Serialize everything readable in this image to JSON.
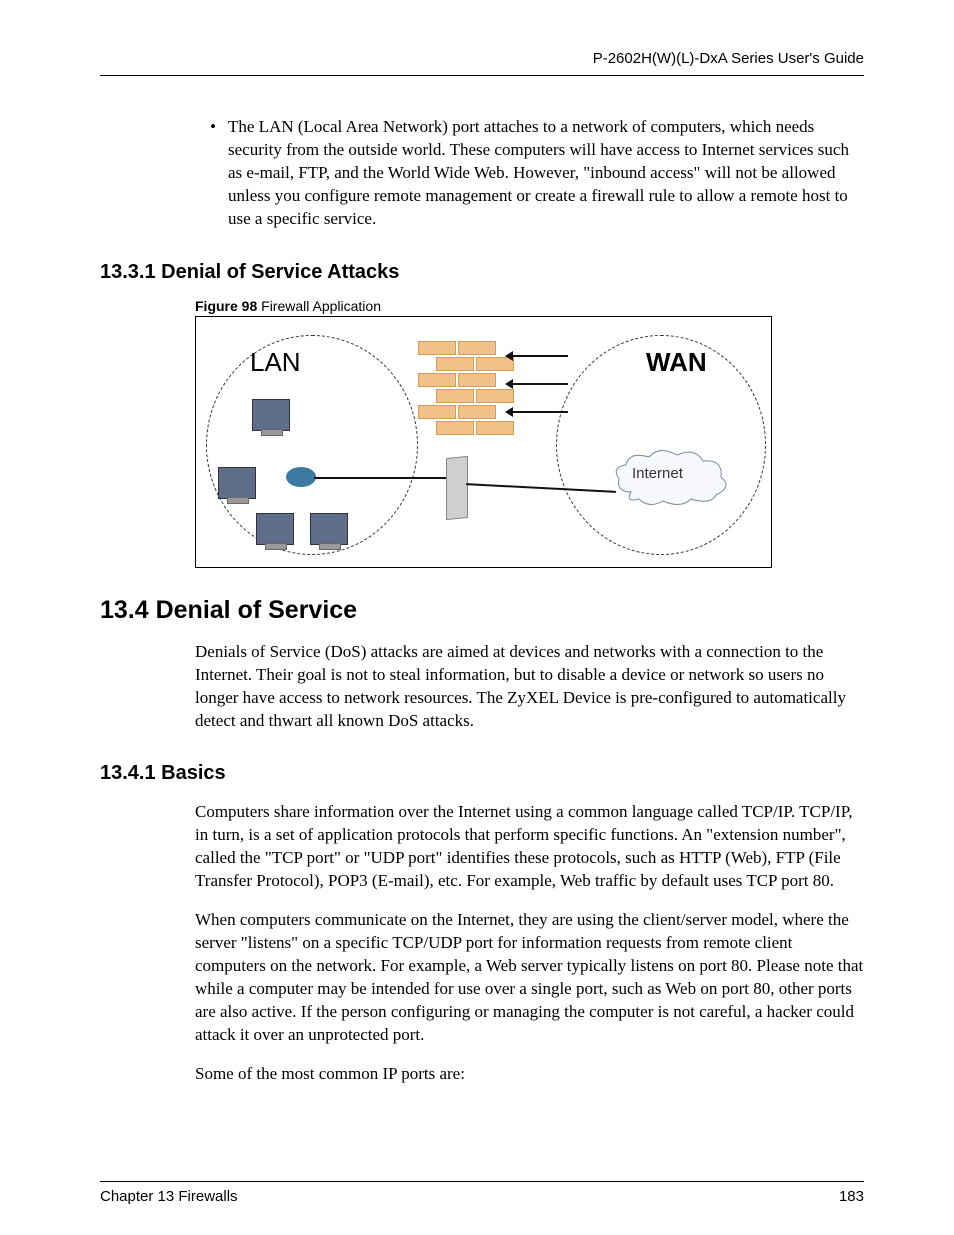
{
  "header": {
    "guide_title": "P-2602H(W)(L)-DxA Series User's Guide"
  },
  "bullet": {
    "text": "The LAN (Local Area Network) port attaches to a network of computers, which needs security from the outside world. These computers will have access to Internet services such as e-mail, FTP, and the World Wide Web.  However, \"inbound access\" will not be allowed unless you configure remote management or create a firewall rule to allow a remote host to use a specific service."
  },
  "sections": {
    "s1331_title": "13.3.1  Denial of Service Attacks",
    "fig98_label_bold": "Figure 98",
    "fig98_label_rest": "   Firewall Application",
    "s134_title": "13.4  Denial of Service",
    "s134_para": "Denials of Service (DoS) attacks are aimed at devices and networks with a connection to the Internet. Their goal is not to steal information, but to disable a device or network so users no longer have access to network resources. The ZyXEL Device is pre-configured to automatically detect and thwart all known DoS attacks.",
    "s1341_title": "13.4.1  Basics",
    "s1341_p1": "Computers share information over the Internet using a common language called TCP/IP. TCP/IP, in turn, is a set of application protocols that perform specific functions. An \"extension number\", called the \"TCP port\" or \"UDP port\" identifies these protocols, such as HTTP (Web), FTP (File Transfer Protocol), POP3 (E-mail), etc. For example, Web traffic by default uses TCP port 80.",
    "s1341_p2": "When computers communicate on the Internet, they are using the client/server model, where the server \"listens\" on a specific TCP/UDP port for information requests from remote client computers on the network. For example, a Web server typically listens on port 80. Please note that while a computer may be intended for use over a single port, such as Web on port 80, other ports are also active. If the person configuring or managing the computer is not careful, a hacker could attack it over an unprotected port.",
    "s1341_p3": "Some of the most common IP ports are:"
  },
  "diagram": {
    "lan_label": "LAN",
    "wan_label": "WAN",
    "internet_label": "Internet"
  },
  "footer": {
    "chapter": "Chapter 13 Firewalls",
    "page": "183"
  }
}
